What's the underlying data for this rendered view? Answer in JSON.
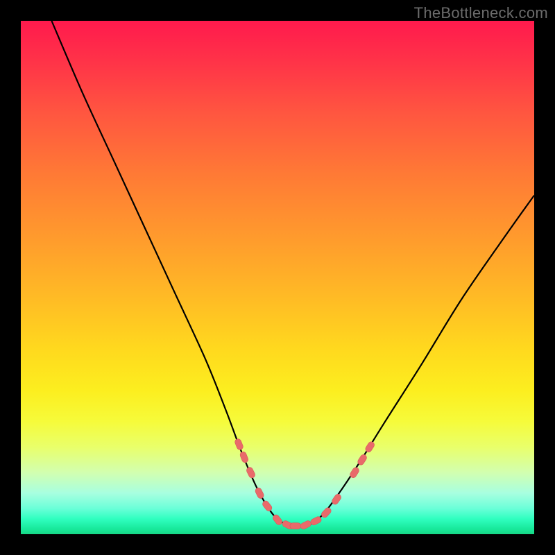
{
  "watermark": "TheBottleneck.com",
  "colors": {
    "frame": "#000000",
    "curve": "#000000",
    "marker": "#e96a6a",
    "marker_stroke": "#d85a5a"
  },
  "chart_data": {
    "type": "line",
    "title": "",
    "xlabel": "",
    "ylabel": "",
    "xlim": [
      0,
      100
    ],
    "ylim": [
      0,
      100
    ],
    "x": [
      6,
      12,
      18,
      24,
      30,
      36,
      40,
      43,
      46,
      49,
      51.5,
      54,
      56.5,
      59,
      62,
      66,
      71,
      78,
      86,
      95,
      100
    ],
    "y": [
      100,
      86,
      73,
      60,
      47,
      34,
      24,
      16,
      9,
      4,
      2,
      1.5,
      2,
      4,
      8,
      14,
      22,
      33,
      46,
      59,
      66
    ],
    "annotations": [
      {
        "type": "marker",
        "x": 42.5,
        "y": 17.5
      },
      {
        "type": "marker",
        "x": 43.5,
        "y": 15
      },
      {
        "type": "marker",
        "x": 44.8,
        "y": 12
      },
      {
        "type": "marker",
        "x": 46.5,
        "y": 8
      },
      {
        "type": "marker",
        "x": 48,
        "y": 5.5
      },
      {
        "type": "marker",
        "x": 50,
        "y": 2.8
      },
      {
        "type": "marker",
        "x": 52,
        "y": 1.8
      },
      {
        "type": "marker",
        "x": 53.5,
        "y": 1.6
      },
      {
        "type": "marker",
        "x": 55.5,
        "y": 1.8
      },
      {
        "type": "marker",
        "x": 57.5,
        "y": 2.6
      },
      {
        "type": "marker",
        "x": 59.5,
        "y": 4.2
      },
      {
        "type": "marker",
        "x": 61.5,
        "y": 6.8
      },
      {
        "type": "marker",
        "x": 65,
        "y": 12
      },
      {
        "type": "marker",
        "x": 66.5,
        "y": 14.5
      },
      {
        "type": "marker",
        "x": 68,
        "y": 17
      }
    ],
    "bands": [
      {
        "y_from": 0,
        "y_to": 3,
        "color": "#17d785"
      },
      {
        "y_from": 3,
        "y_to": 8,
        "color": "#6affd8"
      },
      {
        "y_from": 8,
        "y_to": 18,
        "color": "#f6fb3a"
      },
      {
        "y_from": 18,
        "y_to": 55,
        "color": "#ff9a2d"
      },
      {
        "y_from": 55,
        "y_to": 100,
        "color": "#ff1a4d"
      }
    ]
  }
}
